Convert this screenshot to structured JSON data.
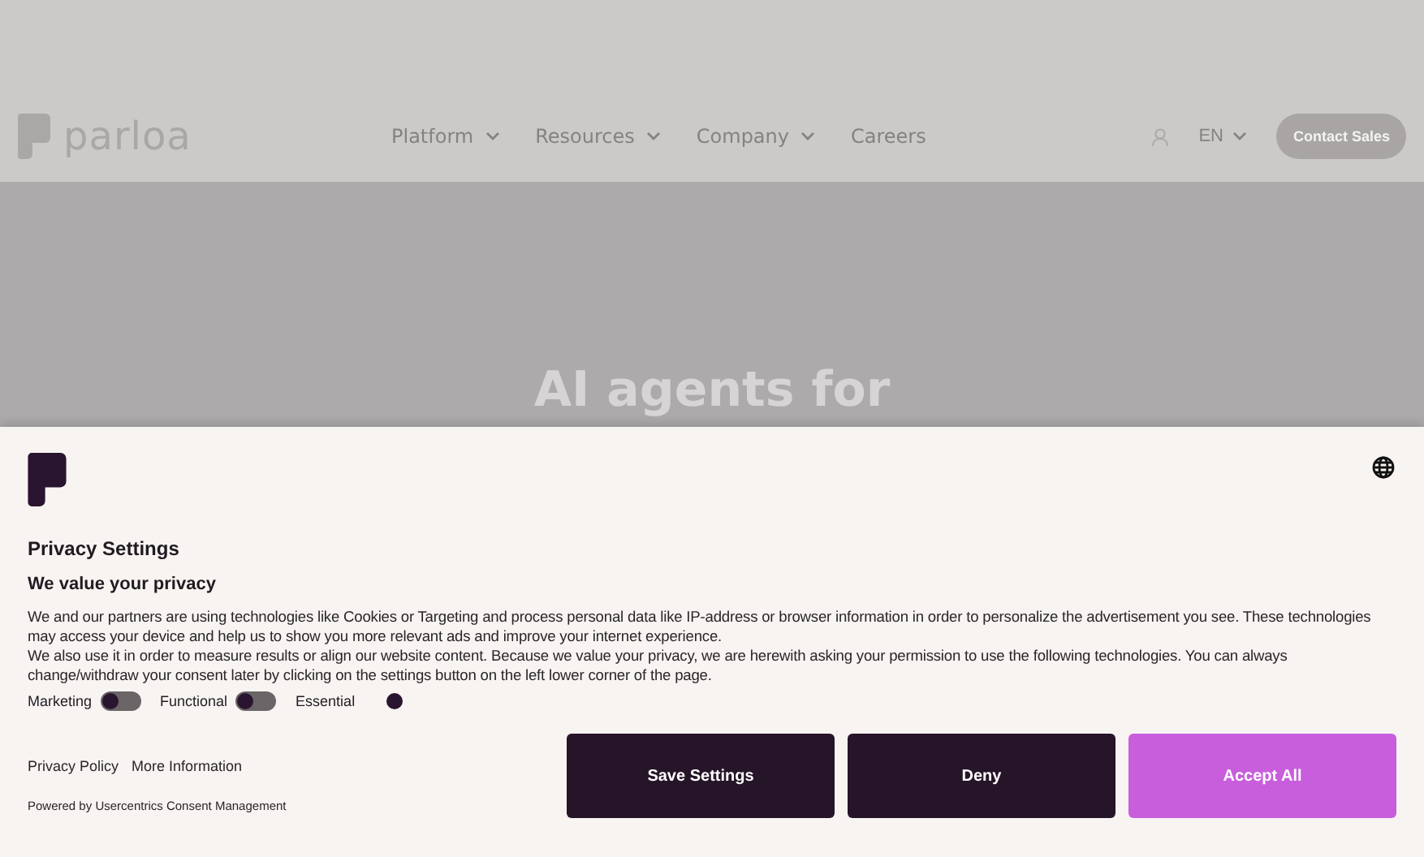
{
  "header": {
    "logo_text": "parloa",
    "nav": [
      {
        "label": "Platform",
        "has_menu": true
      },
      {
        "label": "Resources",
        "has_menu": true
      },
      {
        "label": "Company",
        "has_menu": true
      },
      {
        "label": "Careers",
        "has_menu": false
      }
    ],
    "language": "EN",
    "cta": "Contact Sales"
  },
  "hero": {
    "heading": "AI agents for"
  },
  "consent": {
    "title": "Privacy Settings",
    "subtitle": "We value your privacy",
    "body": "We and our partners are using technologies like Cookies or Targeting and process personal data like IP-address or browser information in order to personalize the advertisement you see. These technologies may access your device and help us to show you more relevant ads and improve your internet experience.\nWe also use it in order to measure results or align our website content. Because we value your privacy, we are herewith asking your permission to use the following technologies. You can always change/withdraw your consent later by clicking on the settings button on the left lower corner of the page.",
    "toggles": [
      {
        "label": "Marketing",
        "on": false
      },
      {
        "label": "Functional",
        "on": false
      },
      {
        "label": "Essential",
        "on": true
      }
    ],
    "links": [
      "Privacy Policy",
      "More Information"
    ],
    "powered_by": "Powered by Usercentrics Consent Management",
    "buttons": [
      {
        "label": "Save Settings",
        "kind": "dark"
      },
      {
        "label": "Deny",
        "kind": "dark"
      },
      {
        "label": "Accept All",
        "kind": "accent"
      }
    ]
  }
}
